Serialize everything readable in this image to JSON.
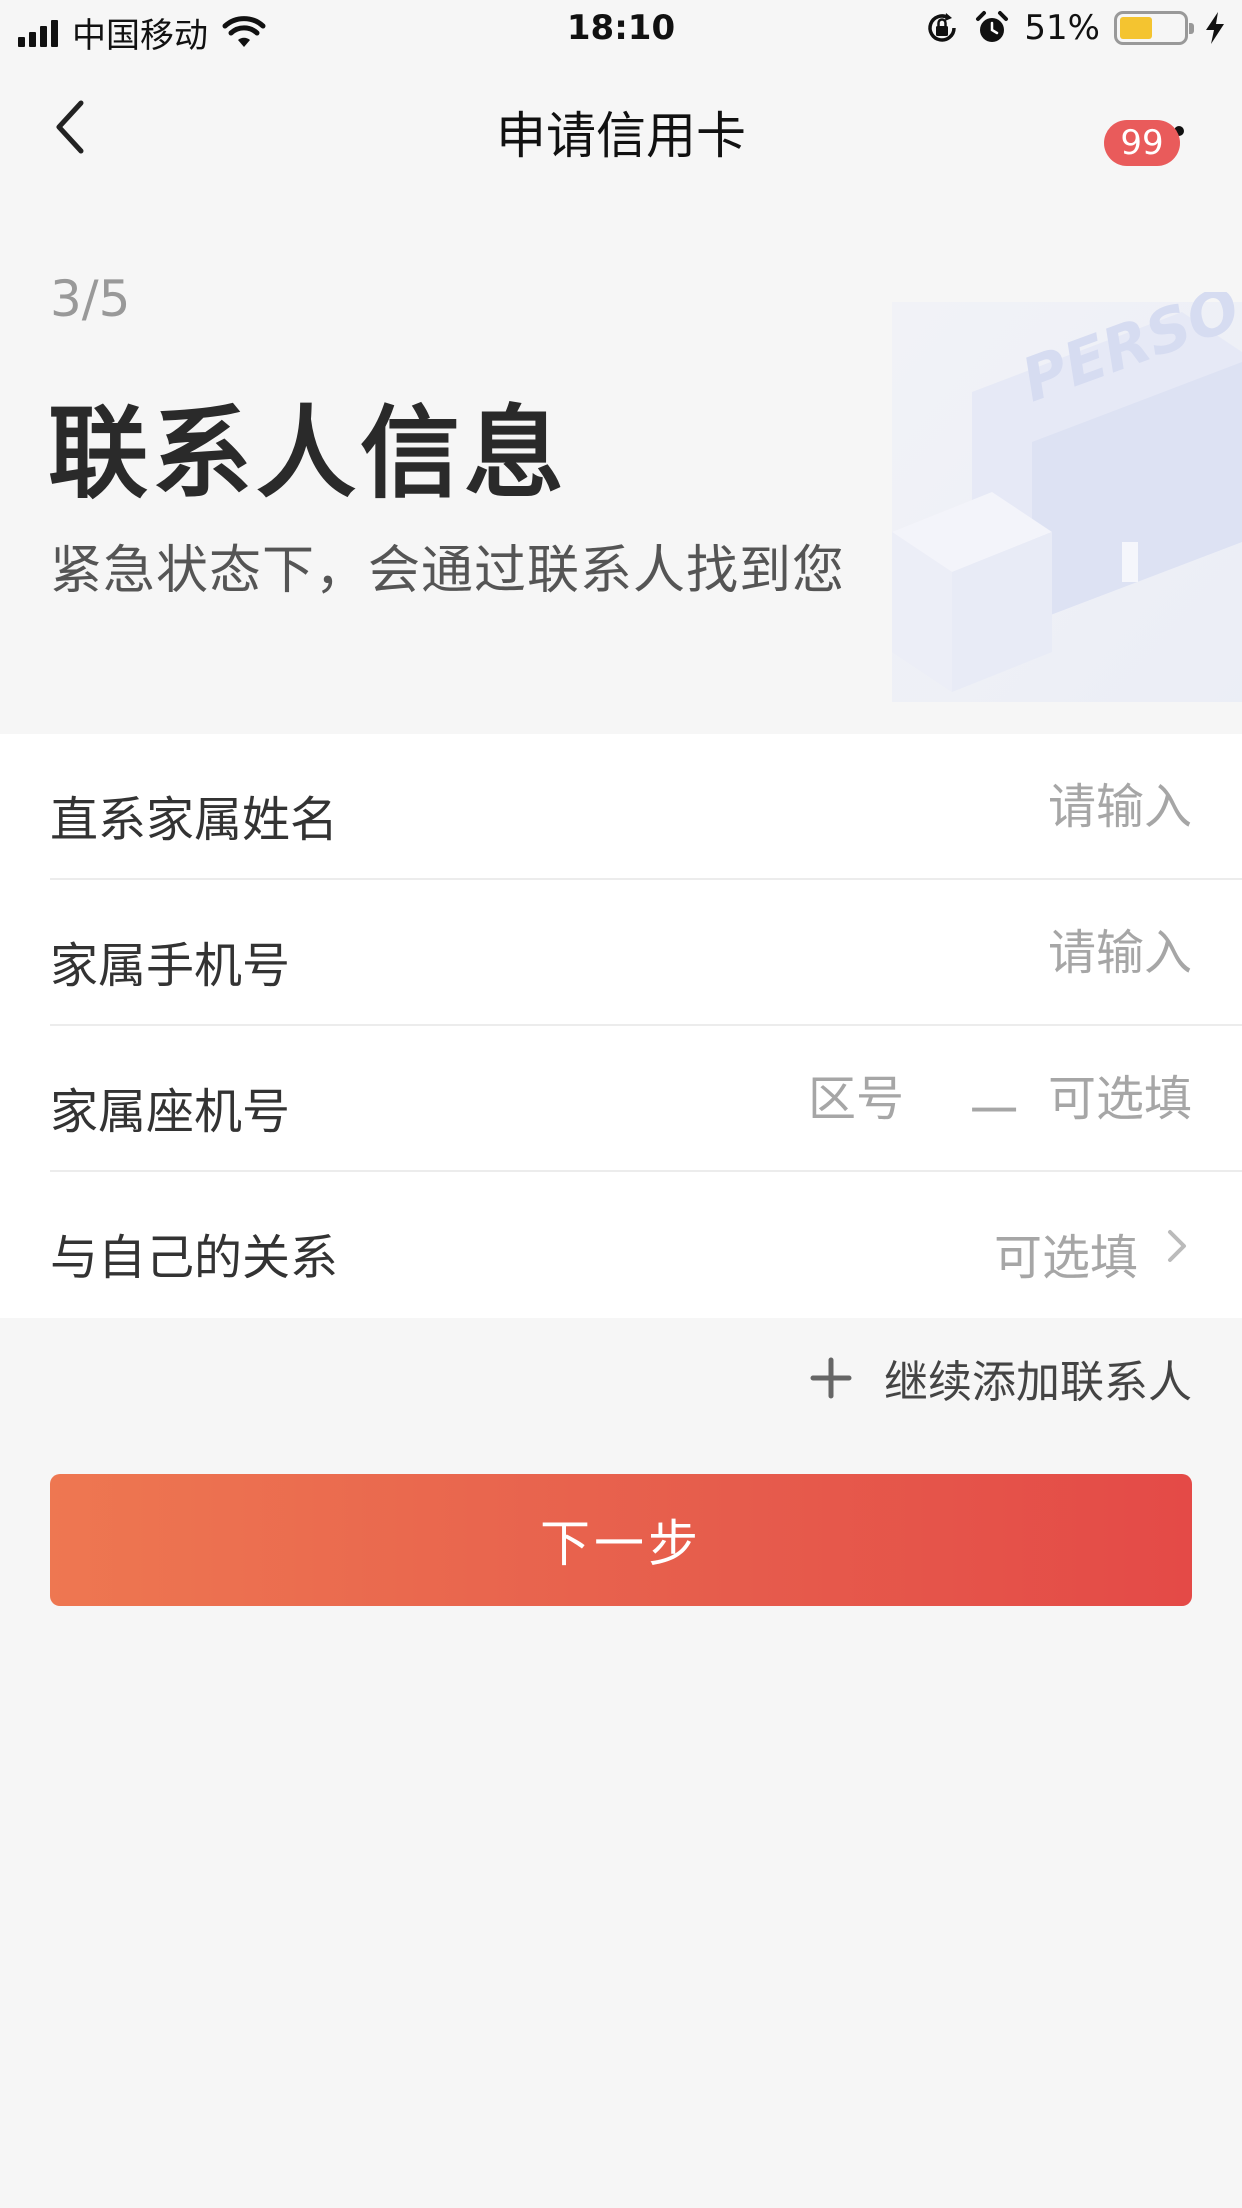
{
  "status_bar": {
    "carrier": "中国移动",
    "time": "18:10",
    "battery_percent": "51%",
    "battery_level": 0.51,
    "icons": [
      "signal-icon",
      "wifi-icon",
      "orientation-lock-icon",
      "alarm-icon",
      "battery-icon",
      "charging-bolt-icon"
    ]
  },
  "nav": {
    "title": "申请信用卡",
    "badge": "99"
  },
  "header": {
    "step": "3/5",
    "title": "联系人信息",
    "subtitle": "紧急状态下，会通过联系人找到您",
    "illustration_text": "PERSO"
  },
  "form": {
    "fields": [
      {
        "label": "直系家属姓名",
        "placeholder": "请输入"
      },
      {
        "label": "家属手机号",
        "placeholder": "请输入"
      },
      {
        "label": "家属座机号",
        "area_placeholder": "区号",
        "separator": "一",
        "placeholder": "可选填"
      },
      {
        "label": "与自己的关系",
        "value": "可选填"
      }
    ]
  },
  "add_contact": {
    "label": "继续添加联系人"
  },
  "next_button": {
    "label": "下一步"
  },
  "colors": {
    "background": "#f6f6f6",
    "badge": "#e95b5b",
    "button_gradient_start": "#ee7751",
    "button_gradient_end": "#e44a47",
    "placeholder": "#a6a6a6"
  }
}
